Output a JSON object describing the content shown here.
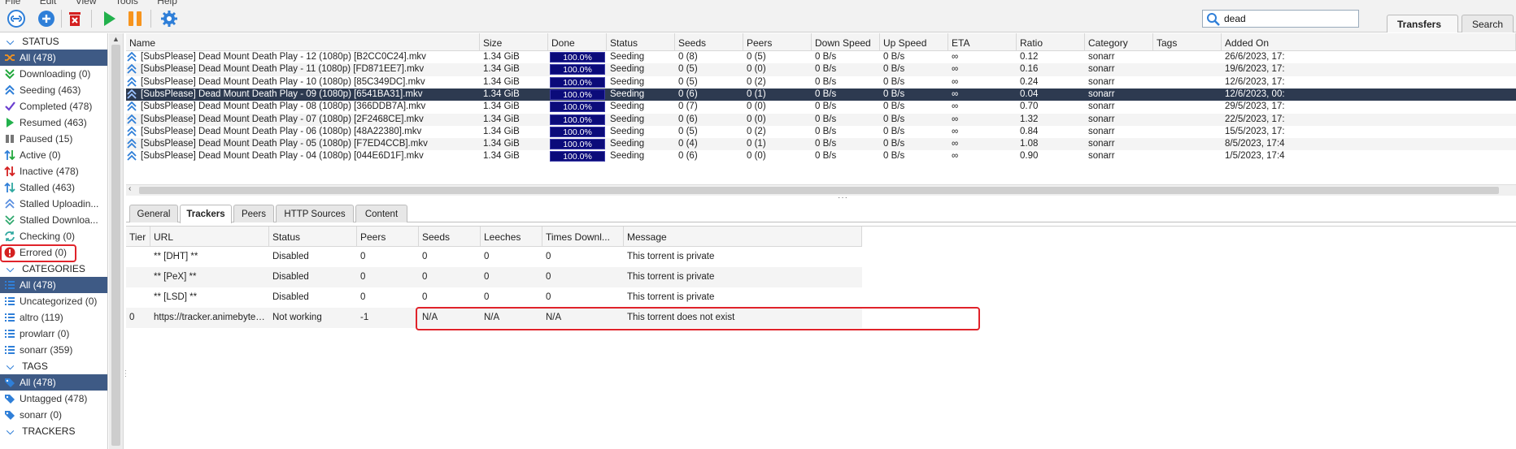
{
  "menu": [
    "File",
    "Edit",
    "View",
    "Tools",
    "Help"
  ],
  "toolbar": {
    "buttons": [
      "add-link",
      "add-torrent",
      "delete",
      "resume",
      "pause",
      "options"
    ]
  },
  "search": {
    "value": "dead"
  },
  "top_tabs": [
    "Transfers",
    "Search"
  ],
  "sidebar": {
    "status_header": "STATUS",
    "status_items": [
      {
        "label": "All (478)",
        "icon": "shuffle-icon",
        "selected": true
      },
      {
        "label": "Downloading (0)",
        "icon": "download-icon"
      },
      {
        "label": "Seeding (463)",
        "icon": "upload-icon"
      },
      {
        "label": "Completed (478)",
        "icon": "check-icon"
      },
      {
        "label": "Resumed (463)",
        "icon": "play-icon"
      },
      {
        "label": "Paused (15)",
        "icon": "pause-icon"
      },
      {
        "label": "Active (0)",
        "icon": "updown-icon"
      },
      {
        "label": "Inactive (478)",
        "icon": "updown-red-icon"
      },
      {
        "label": "Stalled (463)",
        "icon": "stalled-icon"
      },
      {
        "label": "Stalled Uploadin...",
        "icon": "stalled-up-icon"
      },
      {
        "label": "Stalled Downloa...",
        "icon": "stalled-down-icon"
      },
      {
        "label": "Checking (0)",
        "icon": "refresh-icon"
      },
      {
        "label": "Errored (0)",
        "icon": "error-icon"
      }
    ],
    "categories_header": "CATEGORIES",
    "category_items": [
      {
        "label": "All (478)",
        "selected": true
      },
      {
        "label": "Uncategorized (0)"
      },
      {
        "label": "altro (119)"
      },
      {
        "label": "prowlarr (0)"
      },
      {
        "label": "sonarr (359)"
      }
    ],
    "tags_header": "TAGS",
    "tag_items": [
      {
        "label": "All (478)",
        "selected": true
      },
      {
        "label": "Untagged (478)"
      },
      {
        "label": "sonarr (0)"
      }
    ],
    "trackers_header": "TRACKERS"
  },
  "torrent_table": {
    "columns": [
      "Name",
      "Size",
      "Done",
      "Status",
      "Seeds",
      "Peers",
      "Down Speed",
      "Up Speed",
      "ETA",
      "Ratio",
      "Category",
      "Tags",
      "Added On"
    ],
    "rows": [
      {
        "name": "[SubsPlease] Dead Mount Death Play - 12 (1080p) [B2CC0C24].mkv",
        "size": "1.34 GiB",
        "done": "100.0%",
        "status": "Seeding",
        "seeds": "0 (8)",
        "peers": "0 (5)",
        "down": "0 B/s",
        "up": "0 B/s",
        "eta": "∞",
        "ratio": "0.12",
        "category": "sonarr",
        "tags": "",
        "added": "26/6/2023, 17:"
      },
      {
        "name": "[SubsPlease] Dead Mount Death Play - 11 (1080p) [FD871EE7].mkv",
        "size": "1.34 GiB",
        "done": "100.0%",
        "status": "Seeding",
        "seeds": "0 (5)",
        "peers": "0 (0)",
        "down": "0 B/s",
        "up": "0 B/s",
        "eta": "∞",
        "ratio": "0.16",
        "category": "sonarr",
        "tags": "",
        "added": "19/6/2023, 17:"
      },
      {
        "name": "[SubsPlease] Dead Mount Death Play - 10 (1080p) [85C349DC].mkv",
        "size": "1.34 GiB",
        "done": "100.0%",
        "status": "Seeding",
        "seeds": "0 (5)",
        "peers": "0 (2)",
        "down": "0 B/s",
        "up": "0 B/s",
        "eta": "∞",
        "ratio": "0.24",
        "category": "sonarr",
        "tags": "",
        "added": "12/6/2023, 17:"
      },
      {
        "name": "[SubsPlease] Dead Mount Death Play - 09 (1080p) [6541BA31].mkv",
        "size": "1.34 GiB",
        "done": "100.0%",
        "status": "Seeding",
        "seeds": "0 (6)",
        "peers": "0 (1)",
        "down": "0 B/s",
        "up": "0 B/s",
        "eta": "∞",
        "ratio": "0.04",
        "category": "sonarr",
        "tags": "",
        "added": "12/6/2023, 00:",
        "selected": true
      },
      {
        "name": "[SubsPlease] Dead Mount Death Play - 08 (1080p) [366DDB7A].mkv",
        "size": "1.34 GiB",
        "done": "100.0%",
        "status": "Seeding",
        "seeds": "0 (7)",
        "peers": "0 (0)",
        "down": "0 B/s",
        "up": "0 B/s",
        "eta": "∞",
        "ratio": "0.70",
        "category": "sonarr",
        "tags": "",
        "added": "29/5/2023, 17:"
      },
      {
        "name": "[SubsPlease] Dead Mount Death Play - 07 (1080p) [2F2468CE].mkv",
        "size": "1.34 GiB",
        "done": "100.0%",
        "status": "Seeding",
        "seeds": "0 (6)",
        "peers": "0 (0)",
        "down": "0 B/s",
        "up": "0 B/s",
        "eta": "∞",
        "ratio": "1.32",
        "category": "sonarr",
        "tags": "",
        "added": "22/5/2023, 17:"
      },
      {
        "name": "[SubsPlease] Dead Mount Death Play - 06 (1080p) [48A22380].mkv",
        "size": "1.34 GiB",
        "done": "100.0%",
        "status": "Seeding",
        "seeds": "0 (5)",
        "peers": "0 (2)",
        "down": "0 B/s",
        "up": "0 B/s",
        "eta": "∞",
        "ratio": "0.84",
        "category": "sonarr",
        "tags": "",
        "added": "15/5/2023, 17:"
      },
      {
        "name": "[SubsPlease] Dead Mount Death Play - 05 (1080p) [F7ED4CCB].mkv",
        "size": "1.34 GiB",
        "done": "100.0%",
        "status": "Seeding",
        "seeds": "0 (4)",
        "peers": "0 (1)",
        "down": "0 B/s",
        "up": "0 B/s",
        "eta": "∞",
        "ratio": "1.08",
        "category": "sonarr",
        "tags": "",
        "added": "8/5/2023, 17:4"
      },
      {
        "name": "[SubsPlease] Dead Mount Death Play - 04 (1080p) [044E6D1F].mkv",
        "size": "1.34 GiB",
        "done": "100.0%",
        "status": "Seeding",
        "seeds": "0 (6)",
        "peers": "0 (0)",
        "down": "0 B/s",
        "up": "0 B/s",
        "eta": "∞",
        "ratio": "0.90",
        "category": "sonarr",
        "tags": "",
        "added": "1/5/2023, 17:4"
      }
    ]
  },
  "detail_tabs": [
    {
      "label": "General"
    },
    {
      "label": "Trackers",
      "active": true
    },
    {
      "label": "Peers"
    },
    {
      "label": "HTTP Sources"
    },
    {
      "label": "Content"
    }
  ],
  "trackers_table": {
    "columns": [
      "Tier",
      "URL",
      "Status",
      "Peers",
      "Seeds",
      "Leeches",
      "Times Downl...",
      "Message"
    ],
    "rows": [
      {
        "tier": "",
        "url": "** [DHT] **",
        "status": "Disabled",
        "peers": "0",
        "seeds": "0",
        "leeches": "0",
        "downloaded": "0",
        "message": "This torrent is private"
      },
      {
        "tier": "",
        "url": "** [PeX] **",
        "status": "Disabled",
        "peers": "0",
        "seeds": "0",
        "leeches": "0",
        "downloaded": "0",
        "message": "This torrent is private"
      },
      {
        "tier": "",
        "url": "** [LSD] **",
        "status": "Disabled",
        "peers": "0",
        "seeds": "0",
        "leeches": "0",
        "downloaded": "0",
        "message": "This torrent is private"
      },
      {
        "tier": "0",
        "url": "https://tracker.animebytes.tv...",
        "status": "Not working",
        "peers": "-1",
        "seeds": "N/A",
        "leeches": "N/A",
        "downloaded": "N/A",
        "message": "This torrent does not exist"
      }
    ]
  },
  "colors": {
    "accent": "#2f7fd8",
    "selection": "#3e5a85",
    "row_selected": "#2d3a50",
    "progress": "#0b0b7a",
    "highlight_box": "#e0232a"
  }
}
